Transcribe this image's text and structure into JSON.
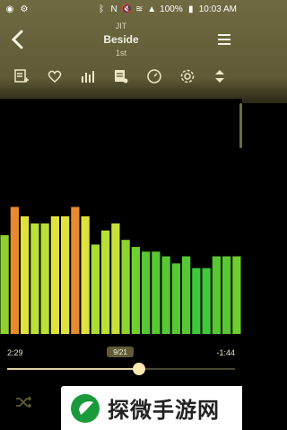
{
  "status_bar": {
    "left_icons": [
      "app-notification-icon",
      "settings-cog-icon"
    ],
    "right_icons": [
      "bluetooth-icon",
      "nfc-icon",
      "mute-icon",
      "wifi-icon",
      "signal-icon",
      "battery-icon"
    ],
    "battery": "100%",
    "time": "10:03 AM"
  },
  "header": {
    "artist": "JIT",
    "title": "Beside",
    "album": "1st"
  },
  "toolbar": {
    "items": [
      {
        "name": "add-to-playlist-icon"
      },
      {
        "name": "heart-icon"
      },
      {
        "name": "equalizer-icon"
      },
      {
        "name": "lyrics-icon"
      },
      {
        "name": "timer-icon"
      },
      {
        "name": "settings-icon"
      },
      {
        "name": "expand-collapse-icon"
      }
    ]
  },
  "visualizer": {
    "type": "bar",
    "levels": [
      0.42,
      0.54,
      0.5,
      0.47,
      0.47,
      0.5,
      0.5,
      0.54,
      0.5,
      0.38,
      0.44,
      0.47,
      0.4,
      0.37,
      0.35,
      0.35,
      0.33,
      0.3,
      0.33,
      0.28,
      0.28,
      0.33,
      0.33,
      0.33
    ],
    "colors": [
      "#8fd12f",
      "#e58a2f",
      "#dfe13f",
      "#b8e037",
      "#b8e037",
      "#dfe13f",
      "#dfe13f",
      "#e58a2f",
      "#dfe13f",
      "#a7dd35",
      "#b8e037",
      "#c8e03b",
      "#8fd12f",
      "#6fcf2f",
      "#57c833",
      "#57c833",
      "#57c833",
      "#57c833",
      "#57c833",
      "#3fc93b",
      "#3fc93b",
      "#57c833",
      "#57c833",
      "#6fcf2f"
    ]
  },
  "progress": {
    "elapsed": "2:29",
    "remaining": "-1:44",
    "track_position": "9/21",
    "fraction": 0.58
  },
  "bottom": {
    "shuffle_icon": "shuffle-icon",
    "watermark_text": "探微手游网"
  }
}
